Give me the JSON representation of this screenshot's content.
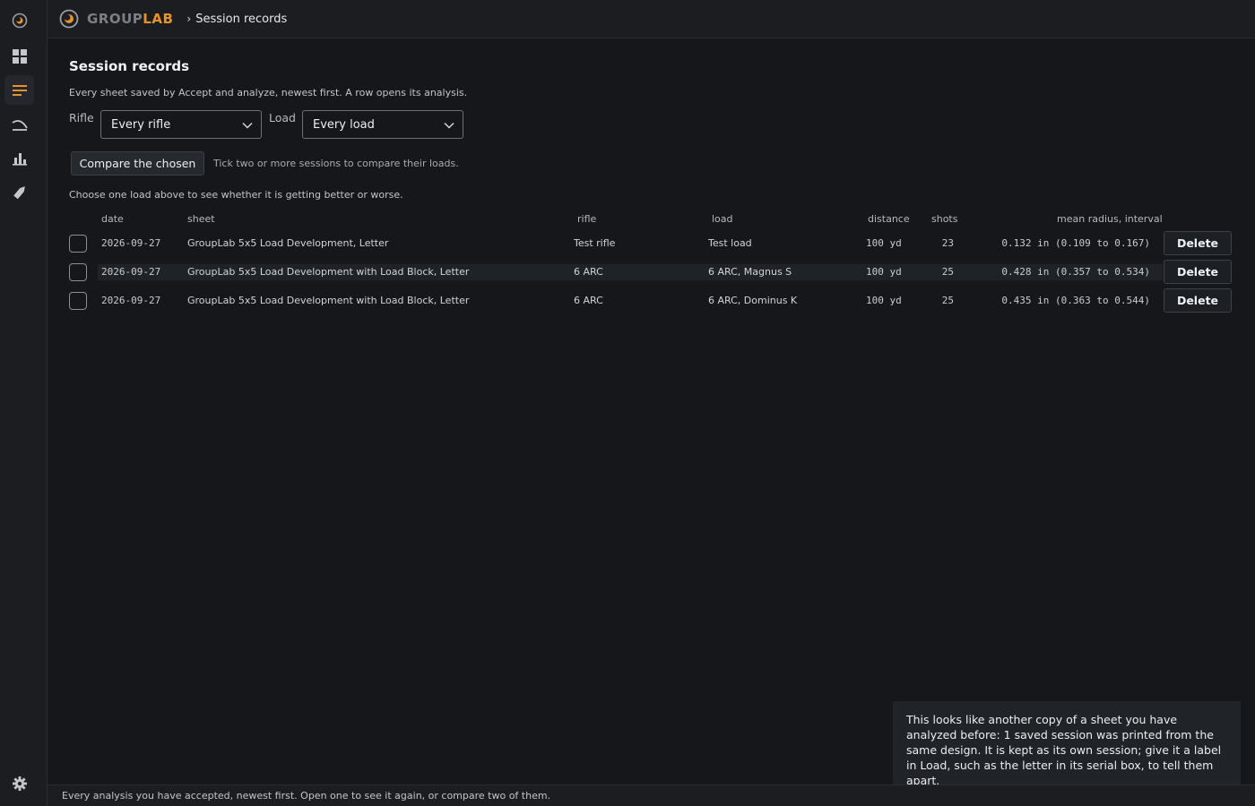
{
  "app": {
    "brand_part1": "GROUP",
    "brand_part2": "LAB",
    "breadcrumb_sep": "›",
    "breadcrumb": "Session records",
    "accent_color": "#e8922c"
  },
  "sidebar": {
    "items": [
      {
        "icon": "logo-icon"
      },
      {
        "icon": "dashboard-icon"
      },
      {
        "icon": "list-icon",
        "active": true
      },
      {
        "icon": "trajectory-icon"
      },
      {
        "icon": "chart-icon"
      },
      {
        "icon": "cartridge-icon"
      },
      {
        "icon": "gear-icon"
      }
    ]
  },
  "page": {
    "title": "Session records",
    "subtitle": "Every sheet saved by Accept and analyze, newest first. A row opens its analysis.",
    "rifle_label": "Rifle",
    "rifle_value": "Every rifle",
    "load_label": "Load",
    "load_value": "Every load",
    "compare_button": "Compare the chosen",
    "compare_hint": "Tick two or more sessions to compare their loads.",
    "trend_hint": "Choose one load above to see whether it is getting better or worse."
  },
  "table": {
    "headers": {
      "date": "date",
      "sheet": "sheet",
      "rifle": "rifle",
      "load": "load",
      "distance": "distance",
      "shots": "shots",
      "mean": "mean radius, interval"
    },
    "delete_label": "Delete",
    "rows": [
      {
        "date": "2026-09-27",
        "sheet": "GroupLab 5x5 Load Development, Letter",
        "rifle": "Test rifle",
        "load": "Test load",
        "distance": "100 yd",
        "shots": "23",
        "mean": "0.132 in (0.109 to 0.167)"
      },
      {
        "date": "2026-09-27",
        "sheet": "GroupLab 5x5 Load Development with Load Block, Letter",
        "rifle": "6 ARC",
        "load": "6 ARC, Magnus S",
        "distance": "100 yd",
        "shots": "25",
        "mean": "0.428 in (0.357 to 0.534)"
      },
      {
        "date": "2026-09-27",
        "sheet": "GroupLab 5x5 Load Development with Load Block, Letter",
        "rifle": "6 ARC",
        "load": "6 ARC, Dominus K",
        "distance": "100 yd",
        "shots": "25",
        "mean": "0.435 in (0.363 to 0.544)"
      }
    ]
  },
  "toast": {
    "text": "This looks like another copy of a sheet you have analyzed before: 1 saved session was printed from the same design. It is kept as its own session; give it a label in Load, such as the letter in its serial box, to tell them apart."
  },
  "statusbar": {
    "text": "Every analysis you have accepted, newest first. Open one to see it again, or compare two of them."
  }
}
